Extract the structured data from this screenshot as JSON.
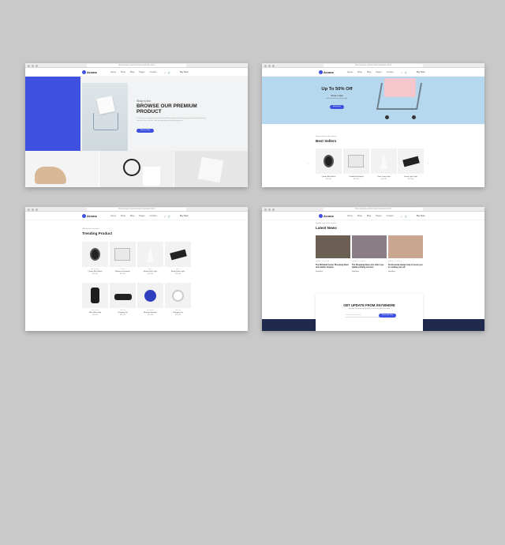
{
  "site": {
    "logo": "Aroma",
    "nav": [
      "Home",
      "Shop",
      "Blog",
      "Pages",
      "Contact"
    ],
    "signin": "Buy Now",
    "url": "themewagon.github.io/aroma/index.html",
    "accent": "#3f51e0",
    "footer_color": "#1f2a4d"
  },
  "hero": {
    "eyebrow": "Shop is fun",
    "title": "BROWSE OUR PREMIUM PRODUCT",
    "text": "Us which over of signs divide dominion deep fill bring they're meat beho upon own earth without morning over third. Their male dry. They are great appear whose land fly grass.",
    "button": "Browse Now"
  },
  "banner": {
    "title": "Up To 50% Off",
    "subtitle": "Winter Sale",
    "text": "Him she'd let them sixth saw light",
    "button": "Shop Now"
  },
  "best_sellers": {
    "eyebrow": "Popular Item in the market",
    "title": "Best Sellers",
    "products": [
      {
        "name": "Quartz Belt Watch",
        "price": "$150.00",
        "icon": "watch-icon"
      },
      {
        "name": "Portable Flashlight",
        "price": "$150.00",
        "icon": "power-bank-icon"
      },
      {
        "name": "Desk Lamp Light",
        "price": "$150.00",
        "icon": "lamp-icon"
      },
      {
        "name": "Smart Light Light",
        "price": "$150.00",
        "icon": "speaker-icon"
      }
    ]
  },
  "trending": {
    "eyebrow": "Click here to see more",
    "title": "Trending Product",
    "products": [
      {
        "category": "Accessories",
        "name": "Quartz Belt Watch",
        "price": "$150.00",
        "icon": "watch-icon"
      },
      {
        "category": "Beauty",
        "name": "Women Freshwash",
        "price": "$150.00",
        "icon": "power-bank-icon"
      },
      {
        "category": "Decor",
        "name": "Room Flash Light",
        "price": "$150.00",
        "icon": "lamp-icon"
      },
      {
        "category": "Decor",
        "name": "Room Flash Light",
        "price": "$150.00",
        "icon": "speaker-icon"
      },
      {
        "category": "Accessories",
        "name": "Man Office Bag",
        "price": "$150.00",
        "icon": "bag-icon"
      },
      {
        "category": "Kids Toy",
        "name": "Charging Car",
        "price": "$150.00",
        "icon": "case-icon"
      },
      {
        "category": "Accessories",
        "name": "Blutooth Speaker",
        "price": "$150.00",
        "icon": "blue-device-icon"
      },
      {
        "category": "Kids Toy",
        "name": "Charging Car",
        "price": "$150.00",
        "icon": "ring-icon"
      }
    ]
  },
  "news": {
    "eyebrow": "Popular Item in the market",
    "title": "Latest News",
    "items": [
      {
        "meta": "By Admin  ·  2 Comments",
        "head": "The Richland Center Shooping News and weekly shopper",
        "more": "Read More"
      },
      {
        "meta": "By Admin  ·  2 Comments",
        "head": "The Shopping News also offers top-quality printing services",
        "more": "Read More"
      },
      {
        "meta": "By Admin  ·  2 Comments",
        "head": "Professional design help to assist you in creating your ad",
        "more": "Read More"
      }
    ]
  },
  "newsletter": {
    "title": "GET UPDATE FROM ANYWHERE",
    "subtitle": "Bearing Void gathering light light his eavening unto dont afraid",
    "placeholder": "Enter your email address",
    "button": "Subscribe Now"
  }
}
